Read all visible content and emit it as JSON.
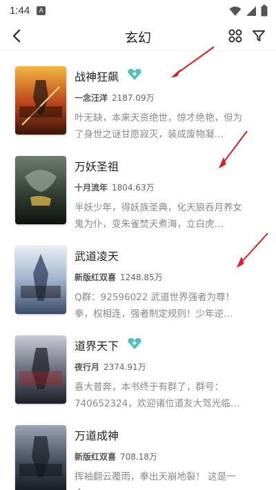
{
  "status_bar": {
    "time": "1:44",
    "app_icon_letter": "A"
  },
  "header": {
    "title": "玄幻"
  },
  "books": [
    {
      "title": "战神狂飙",
      "author": "一念汪洋",
      "wordcount": "2187.09万",
      "description": "叶无缺，本来天资绝世，惊才绝艳，但为了身世之谜甘愿寂灭，装成废物凝…",
      "badge": "heart-diamond-icon"
    },
    {
      "title": "万妖圣祖",
      "author": "十月流年",
      "wordcount": "1804.63万",
      "description": "半妖少年，得妖族圣典，化天狼吞月养女鬼为仆，变朱雀焚天煮海，立白虎…",
      "badge": ""
    },
    {
      "title": "武道凌天",
      "author": "新版红双喜",
      "wordcount": "1248.85万",
      "description": "Q群：92596022 武道世界强者为尊！拳，权相连，强者制定规则！少年逆…",
      "badge": ""
    },
    {
      "title": "道界天下",
      "author": "夜行月",
      "wordcount": "2374.91万",
      "description": "喜大普奔，本书终于有群了，群号：740652324，欢迎诸位道友大驾光临…",
      "badge": "heart-diamond-icon"
    },
    {
      "title": "万道成神",
      "author": "新版红双喜",
      "wordcount": "708.18万",
      "description": "挥袖翻云覆雨，拳出天崩地裂！ 这是一个",
      "badge": ""
    }
  ],
  "colors": {
    "accent_badge": "#4fc3b8",
    "annotation_red": "#e31b23"
  }
}
